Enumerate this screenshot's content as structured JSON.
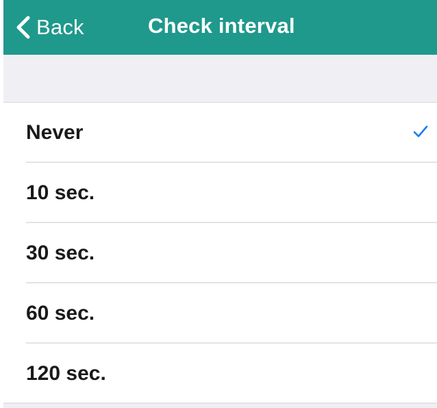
{
  "header": {
    "back_label": "Back",
    "title": "Check interval",
    "back_icon": "chevron-left-icon",
    "background_color": "#1f998c"
  },
  "interval_options": [
    {
      "label": "Never",
      "selected": true
    },
    {
      "label": "10 sec.",
      "selected": false
    },
    {
      "label": "30 sec.",
      "selected": false
    },
    {
      "label": "60 sec.",
      "selected": false
    },
    {
      "label": "120 sec.",
      "selected": false
    }
  ],
  "selection_icon": "checkmark-icon",
  "accent_color": "#1a7cf0"
}
